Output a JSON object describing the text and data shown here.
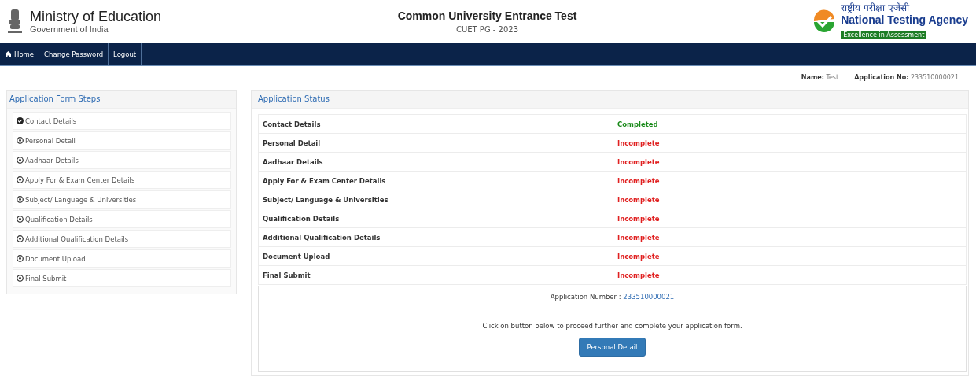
{
  "header": {
    "ministry": "Ministry of Education",
    "government": "Government of India",
    "title": "Common University Entrance Test",
    "subtitle": "CUET PG - 2023",
    "agency_hindi": "राष्ट्रीय परीक्षा एजेंसी",
    "agency": "National Testing Agency",
    "agency_tagline": "Excellence in Assessment"
  },
  "nav": [
    {
      "label": "Home"
    },
    {
      "label": "Change Password"
    },
    {
      "label": "Logout"
    }
  ],
  "user": {
    "name_label": "Name:",
    "name": "Test",
    "app_label": "Application No:",
    "app_no": "233510000021"
  },
  "steps": {
    "title": "Application Form Steps",
    "items": [
      {
        "label": "Contact Details",
        "completed": true
      },
      {
        "label": "Personal Detail",
        "completed": false
      },
      {
        "label": "Aadhaar Details",
        "completed": false
      },
      {
        "label": "Apply For & Exam Center Details",
        "completed": false
      },
      {
        "label": "Subject/ Language & Universities",
        "completed": false
      },
      {
        "label": "Qualification Details",
        "completed": false
      },
      {
        "label": "Additional Qualification Details",
        "completed": false
      },
      {
        "label": "Document Upload",
        "completed": false
      },
      {
        "label": "Final Submit",
        "completed": false
      }
    ]
  },
  "status": {
    "title": "Application Status",
    "rows": [
      {
        "section": "Contact Details",
        "status": "Completed",
        "completed": true
      },
      {
        "section": "Personal Detail",
        "status": "Incomplete",
        "completed": false
      },
      {
        "section": "Aadhaar Details",
        "status": "Incomplete",
        "completed": false
      },
      {
        "section": "Apply For & Exam Center Details",
        "status": "Incomplete",
        "completed": false
      },
      {
        "section": "Subject/ Language & Universities",
        "status": "Incomplete",
        "completed": false
      },
      {
        "section": "Qualification Details",
        "status": "Incomplete",
        "completed": false
      },
      {
        "section": "Additional Qualification Details",
        "status": "Incomplete",
        "completed": false
      },
      {
        "section": "Document Upload",
        "status": "Incomplete",
        "completed": false
      },
      {
        "section": "Final Submit",
        "status": "Incomplete",
        "completed": false
      }
    ]
  },
  "summary": {
    "app_label": "Application Number :",
    "app_no": "233510000021",
    "message": "Click on button below to proceed further and complete your application form.",
    "button": "Personal Detail"
  }
}
